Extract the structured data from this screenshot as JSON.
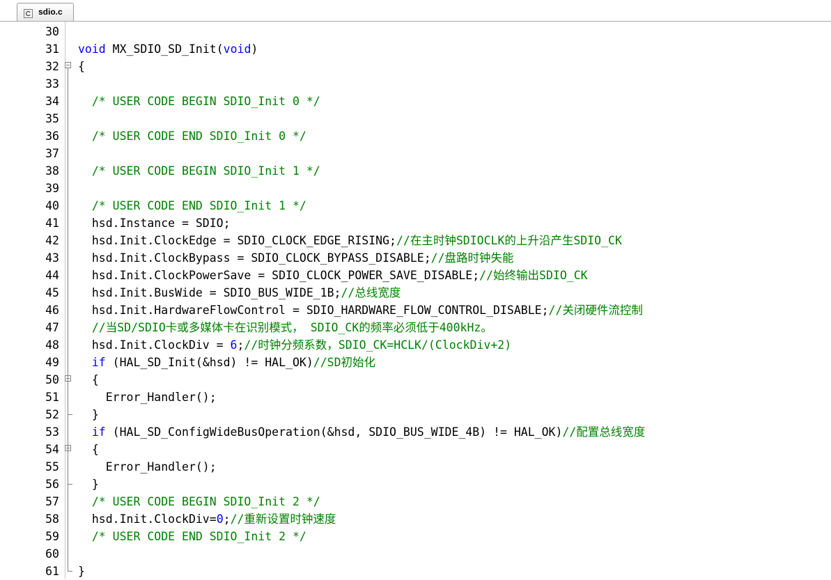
{
  "tab": {
    "label": "sdio.c",
    "icon": "c-file-icon"
  },
  "colors": {
    "keyword": "#0000ff",
    "comment": "#008000",
    "number": "#0000ff",
    "text": "#000000"
  },
  "lines": [
    {
      "n": "30",
      "parts": []
    },
    {
      "n": "31",
      "parts": [
        [
          "kw",
          "void"
        ],
        [
          "t",
          " MX_SDIO_SD_Init("
        ],
        [
          "kw",
          "void"
        ],
        [
          "t",
          ")"
        ]
      ]
    },
    {
      "n": "32",
      "fold": "open",
      "parts": [
        [
          "t",
          "{"
        ]
      ]
    },
    {
      "n": "33",
      "parts": []
    },
    {
      "n": "34",
      "parts": [
        [
          "t",
          "  "
        ],
        [
          "cm",
          "/* USER CODE BEGIN SDIO_Init 0 */"
        ]
      ]
    },
    {
      "n": "35",
      "parts": []
    },
    {
      "n": "36",
      "parts": [
        [
          "t",
          "  "
        ],
        [
          "cm",
          "/* USER CODE END SDIO_Init 0 */"
        ]
      ]
    },
    {
      "n": "37",
      "parts": []
    },
    {
      "n": "38",
      "parts": [
        [
          "t",
          "  "
        ],
        [
          "cm",
          "/* USER CODE BEGIN SDIO_Init 1 */"
        ]
      ]
    },
    {
      "n": "39",
      "parts": []
    },
    {
      "n": "40",
      "parts": [
        [
          "t",
          "  "
        ],
        [
          "cm",
          "/* USER CODE END SDIO_Init 1 */"
        ]
      ]
    },
    {
      "n": "41",
      "parts": [
        [
          "t",
          "  hsd.Instance = SDIO;"
        ]
      ]
    },
    {
      "n": "42",
      "parts": [
        [
          "t",
          "  hsd.Init.ClockEdge = SDIO_CLOCK_EDGE_RISING;"
        ],
        [
          "cm",
          "//在主时钟SDIOCLK的上升沿产生SDIO_CK"
        ]
      ]
    },
    {
      "n": "43",
      "parts": [
        [
          "t",
          "  hsd.Init.ClockBypass = SDIO_CLOCK_BYPASS_DISABLE;"
        ],
        [
          "cm",
          "//盘路时钟失能"
        ]
      ]
    },
    {
      "n": "44",
      "parts": [
        [
          "t",
          "  hsd.Init.ClockPowerSave = SDIO_CLOCK_POWER_SAVE_DISABLE;"
        ],
        [
          "cm",
          "//始终输出SDIO_CK"
        ]
      ]
    },
    {
      "n": "45",
      "parts": [
        [
          "t",
          "  hsd.Init.BusWide = SDIO_BUS_WIDE_1B;"
        ],
        [
          "cm",
          "//总线宽度"
        ]
      ]
    },
    {
      "n": "46",
      "parts": [
        [
          "t",
          "  hsd.Init.HardwareFlowControl = SDIO_HARDWARE_FLOW_CONTROL_DISABLE;"
        ],
        [
          "cm",
          "//关闭硬件流控制"
        ]
      ]
    },
    {
      "n": "47",
      "parts": [
        [
          "t",
          "  "
        ],
        [
          "cm",
          "//当SD/SDIO卡或多媒体卡在识别模式， SDIO_CK的频率必须低于400kHz。"
        ]
      ]
    },
    {
      "n": "48",
      "parts": [
        [
          "t",
          "  hsd.Init.ClockDiv = "
        ],
        [
          "nm",
          "6"
        ],
        [
          "t",
          ";"
        ],
        [
          "cm",
          "//时钟分频系数，SDIO_CK=HCLK/(ClockDiv+2)"
        ]
      ]
    },
    {
      "n": "49",
      "parts": [
        [
          "t",
          "  "
        ],
        [
          "kw",
          "if"
        ],
        [
          "t",
          " (HAL_SD_Init(&hsd) != HAL_OK)"
        ],
        [
          "cm",
          "//SD初始化"
        ]
      ]
    },
    {
      "n": "50",
      "fold": "open",
      "parts": [
        [
          "t",
          "  {"
        ]
      ]
    },
    {
      "n": "51",
      "parts": [
        [
          "t",
          "    Error_Handler();"
        ]
      ]
    },
    {
      "n": "52",
      "fold": "end",
      "parts": [
        [
          "t",
          "  }"
        ]
      ]
    },
    {
      "n": "53",
      "parts": [
        [
          "t",
          "  "
        ],
        [
          "kw",
          "if"
        ],
        [
          "t",
          " (HAL_SD_ConfigWideBusOperation(&hsd, SDIO_BUS_WIDE_4B) != HAL_OK)"
        ],
        [
          "cm",
          "//配置总线宽度"
        ]
      ]
    },
    {
      "n": "54",
      "fold": "open",
      "parts": [
        [
          "t",
          "  {"
        ]
      ]
    },
    {
      "n": "55",
      "parts": [
        [
          "t",
          "    Error_Handler();"
        ]
      ]
    },
    {
      "n": "56",
      "fold": "end",
      "parts": [
        [
          "t",
          "  }"
        ]
      ]
    },
    {
      "n": "57",
      "parts": [
        [
          "t",
          "  "
        ],
        [
          "cm",
          "/* USER CODE BEGIN SDIO_Init 2 */"
        ]
      ]
    },
    {
      "n": "58",
      "parts": [
        [
          "t",
          "  hsd.Init.ClockDiv="
        ],
        [
          "nm",
          "0"
        ],
        [
          "t",
          ";"
        ],
        [
          "cm",
          "//重新设置时钟速度"
        ]
      ]
    },
    {
      "n": "59",
      "parts": [
        [
          "t",
          "  "
        ],
        [
          "cm",
          "/* USER CODE END SDIO_Init 2 */"
        ]
      ]
    },
    {
      "n": "60",
      "parts": []
    },
    {
      "n": "61",
      "fold": "end",
      "parts": [
        [
          "t",
          "}"
        ]
      ]
    }
  ]
}
